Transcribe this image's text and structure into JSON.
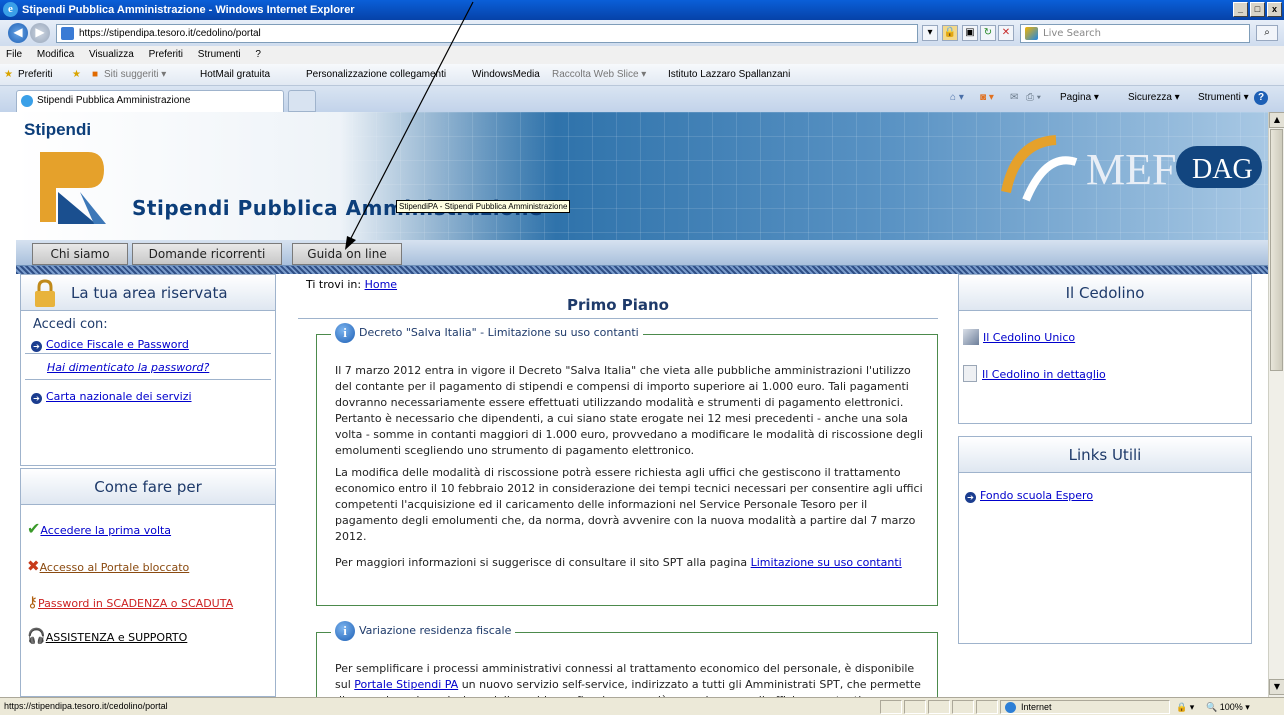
{
  "window": {
    "title": "Stipendi Pubblica Amministrazione - Windows Internet Explorer",
    "min": "_",
    "max": "□",
    "close": "x"
  },
  "addressbar": {
    "url": "https://stipendipa.tesoro.it/cedolino/portal",
    "search_placeholder": "Live Search"
  },
  "menu": [
    "File",
    "Modifica",
    "Visualizza",
    "Preferiti",
    "Strumenti",
    "?"
  ],
  "favorites": {
    "label": "Preferiti",
    "items": [
      "Siti suggeriti ▾",
      "HotMail gratuita",
      "Personalizzazione collegamenti",
      "WindowsMedia",
      "Raccolta Web Slice ▾",
      "Istituto Lazzaro Spallanzani"
    ]
  },
  "tab": {
    "title": "Stipendi Pubblica Amministrazione"
  },
  "commandbar": [
    "Pagina ▾",
    "Sicurezza ▾",
    "Strumenti ▾"
  ],
  "site": {
    "logo_small": "Stipendi",
    "brand": "Stipendi Pubblica Amministrazione",
    "tooltip": "StipendiPA - Stipendi Pubblica Amministrazione",
    "mef": "MEF",
    "dag": "DAG"
  },
  "nav": [
    "Chi siamo",
    "Domande ricorrenti",
    "Guida on line"
  ],
  "left": {
    "area_title": "La tua area riservata",
    "accedi": "Accedi con:",
    "cf_link": "Codice Fiscale e Password",
    "forgot": "Hai dimenticato la password?",
    "cns": "Carta nazionale dei servizi",
    "come_title": "Come fare per",
    "come_items": [
      "Accedere la prima volta",
      "Accesso al Portale bloccato",
      "Password in SCADENZA o SCADUTA",
      "ASSISTENZA e SUPPORTO"
    ]
  },
  "center": {
    "breadcrumb_label": "Ti trovi in:",
    "breadcrumb_home": "Home",
    "title": "Primo Piano",
    "news1": {
      "title": "Decreto \"Salva Italia\" - Limitazione su uso contanti",
      "p1": "Il 7 marzo 2012 entra in vigore il Decreto \"Salva Italia\" che vieta alle pubbliche amministrazioni l'utilizzo del contante per il pagamento di stipendi e compensi di importo superiore ai 1.000 euro. Tali pagamenti dovranno necessariamente essere effettuati utilizzando modalità e strumenti di pagamento elettronici. Pertanto è necessario che dipendenti, a cui siano state erogate nei 12 mesi precedenti - anche una sola volta - somme in contanti maggiori di 1.000 euro, provvedano a modificare le modalità di riscossione degli emolumenti scegliendo uno strumento di pagamento elettronico.",
      "p2": "La modifica delle modalità di riscossione potrà essere richiesta agli uffici che gestiscono il trattamento economico entro il 10 febbraio 2012 in considerazione dei tempi tecnici necessari per consentire agli uffici competenti l'acquisizione ed il caricamento delle informazioni nel Service Personale Tesoro per il pagamento degli emolumenti che, da norma, dovrà avvenire con la nuova modalità a partire dal 7 marzo 2012.",
      "p3_text": "Per maggiori informazioni si suggerisce di consultare il sito SPT alla pagina ",
      "p3_link": "Limitazione su uso contanti"
    },
    "news2": {
      "title": "Variazione residenza fiscale",
      "p1_text": "Per semplificare i processi amministrativi connessi al trattamento economico del personale, è disponibile sul ",
      "p1_link": "Portale Stipendi PA",
      "p1_rest": " un nuovo servizio self-service, indirizzato a tutti gli Amministrati SPT, che permette di comunicare la variazione della residenza fiscale senza più recarsi presso gli uffici competenti."
    }
  },
  "right": {
    "cedolino_title": "Il Cedolino",
    "cedolino_items": [
      "Il Cedolino Unico",
      "Il Cedolino in dettaglio"
    ],
    "links_title": "Links Utili",
    "links_items": [
      "Fondo scuola Espero"
    ]
  },
  "status": {
    "url": "https://stipendipa.tesoro.it/cedolino/portal",
    "zone": "Internet",
    "zoom": "100%"
  }
}
